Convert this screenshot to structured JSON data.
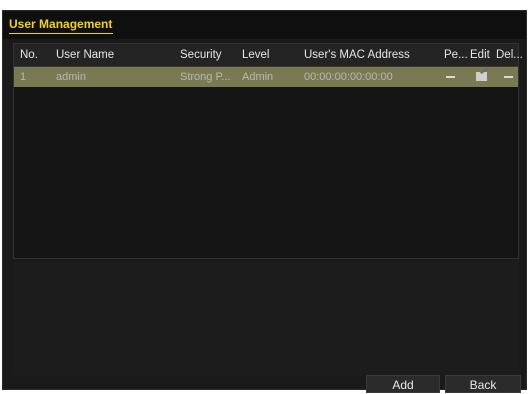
{
  "window": {
    "tab_title": "User Management"
  },
  "table": {
    "columns": [
      "No.",
      "User Name",
      "Security",
      "Level",
      "User's MAC Address",
      "Pe...",
      "Edit",
      "Del..."
    ],
    "rows": [
      {
        "no": "1",
        "user_name": "admin",
        "security": "Strong P...",
        "level": "Admin",
        "mac": "00:00:00:00:00:00",
        "permission": "—",
        "edit_icon": "edit-icon",
        "delete": "—"
      }
    ]
  },
  "buttons": {
    "add": "Add",
    "back": "Back"
  },
  "colors": {
    "accent": "#f2d21e",
    "selected_row": "#7a7a52"
  }
}
